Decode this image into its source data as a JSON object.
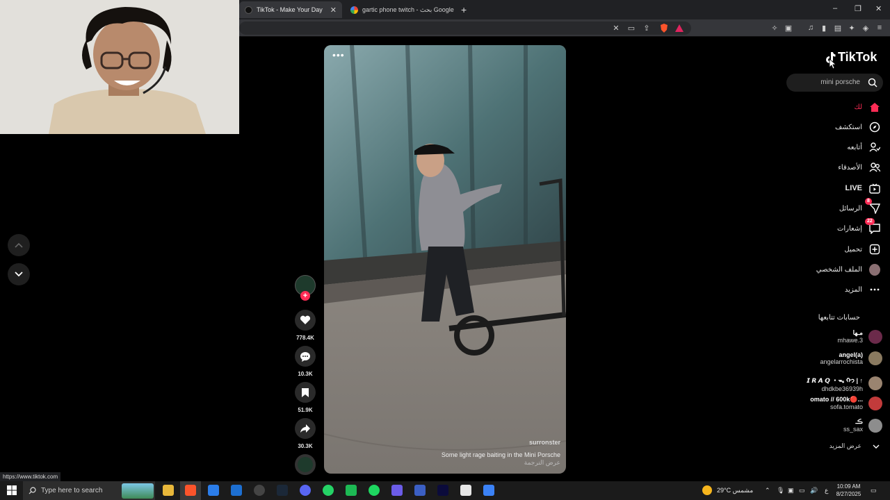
{
  "browser": {
    "tabs": [
      {
        "title": "TikTok - Make Your Day",
        "active": true
      },
      {
        "title": "gartic phone twitch - بحث Google",
        "active": false
      }
    ],
    "new_tab": "+",
    "controls": {
      "minimize": "–",
      "restore": "❐",
      "close": "✕"
    }
  },
  "nav": {
    "up": "up",
    "down": "down"
  },
  "video": {
    "menu": "•••",
    "author": "surronster",
    "caption": "Some light rage baiting in the Mini Porsche",
    "translate": "عرض الترجمة"
  },
  "actions": {
    "likes": "778.4K",
    "comments": "10.3K",
    "saves": "51.9K",
    "shares": "30.3K",
    "follow_plus": "+"
  },
  "sidebar": {
    "logo_text": "TikTok",
    "search_value": "mini porsche",
    "nav": [
      {
        "label": "لك",
        "icon": "home-icon"
      },
      {
        "label": "استكشف",
        "icon": "compass-icon"
      },
      {
        "label": "أتابعه",
        "icon": "following-icon"
      },
      {
        "label": "الأصدقاء",
        "icon": "friends-icon"
      },
      {
        "label": "LIVE",
        "icon": "live-icon"
      },
      {
        "label": "الرسائل",
        "icon": "messages-icon",
        "badge": "8"
      },
      {
        "label": "إشعارات",
        "icon": "inbox-icon",
        "badge": "22"
      },
      {
        "label": "تحميل",
        "icon": "upload-icon"
      },
      {
        "label": "الملف الشخصي",
        "icon": "profile-avatar"
      },
      {
        "label": "المزيد",
        "icon": "more-icon"
      }
    ],
    "following_title": "حسابات تتابعها",
    "following": [
      {
        "display": "مـها",
        "handle": "mhawe.3",
        "color": "#6b2a4a"
      },
      {
        "display": "angel(a)",
        "handle": "angelarrochista",
        "color": "#8a7a60"
      },
      {
        "display": "𝙄 𝙍 𝘼 𝙌 ・ᯓ ᡣ𐭩 | ↑",
        "handle": "dhdkbe36939h",
        "color": "#9a8470"
      },
      {
        "display": "omato // 600k🔴...",
        "handle": "sofa.tomato",
        "color": "#c23b3b"
      },
      {
        "display": "ڪـ",
        "handle": "ss_sax",
        "color": "#8d8d8d"
      }
    ],
    "see_more": "عرض المزيد"
  },
  "status_url": "https://www.tiktok.com",
  "taskbar": {
    "search_placeholder": "Type here to search",
    "weather": "29°C  مشمس",
    "lang": "ع",
    "time": "10:09 AM",
    "date": "8/27/2025"
  },
  "colors": {
    "accent": "#fe2c55",
    "background": "#000000",
    "chrome": "#202124"
  }
}
